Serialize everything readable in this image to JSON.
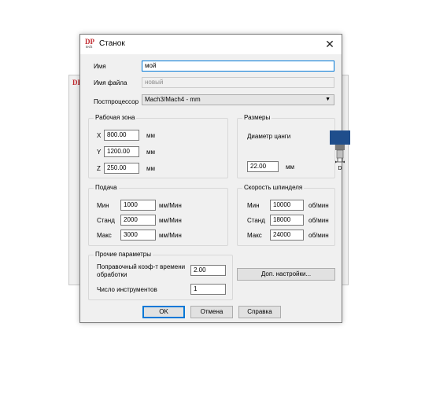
{
  "background_dialog": {
    "logo": "DP"
  },
  "dialog": {
    "title": "Станок",
    "logo_top": "DP",
    "logo_bottom": "tech",
    "close": "✕"
  },
  "form": {
    "name_label": "Имя",
    "name_value": "мой",
    "filename_label": "Имя файла",
    "filename_value": "новый",
    "postprocessor_label": "Постпроцессор",
    "postprocessor_value": "Mach3/Mach4 - mm"
  },
  "work_area": {
    "title": "Рабочая зона",
    "rows": [
      {
        "axis": "X",
        "value": "800.00",
        "unit": "мм"
      },
      {
        "axis": "Y",
        "value": "1200.00",
        "unit": "мм"
      },
      {
        "axis": "Z",
        "value": "250.00",
        "unit": "мм"
      }
    ]
  },
  "sizes": {
    "title": "Размеры",
    "collet_label": "Диаметр цанги",
    "collet_value": "22.00",
    "collet_unit": "мм",
    "diagram_label": "D"
  },
  "feed": {
    "title": "Подача",
    "rows": [
      {
        "label": "Мин",
        "value": "1000",
        "unit": "мм/Мин"
      },
      {
        "label": "Станд",
        "value": "2000",
        "unit": "мм/Мин"
      },
      {
        "label": "Макс",
        "value": "3000",
        "unit": "мм/Мин"
      }
    ]
  },
  "spindle": {
    "title": "Скорость шпинделя",
    "rows": [
      {
        "label": "Мин",
        "value": "10000",
        "unit": "об/мин"
      },
      {
        "label": "Станд",
        "value": "18000",
        "unit": "об/мин"
      },
      {
        "label": "Макс",
        "value": "24000",
        "unit": "об/мин"
      }
    ]
  },
  "other": {
    "title": "Прочие параметры",
    "coef_label_1": "Поправочный коэф-т времени",
    "coef_label_2": "обработки",
    "coef_value": "2.00",
    "tools_label": "Число инструментов",
    "tools_value": "1"
  },
  "buttons": {
    "extra": "Доп. настройки...",
    "ok": "OK",
    "cancel": "Отмена",
    "help": "Справка"
  },
  "colors": {
    "focus_border": "#0078d7",
    "collet_blue": "#1f4e8c",
    "logo_red": "#c0282d"
  }
}
